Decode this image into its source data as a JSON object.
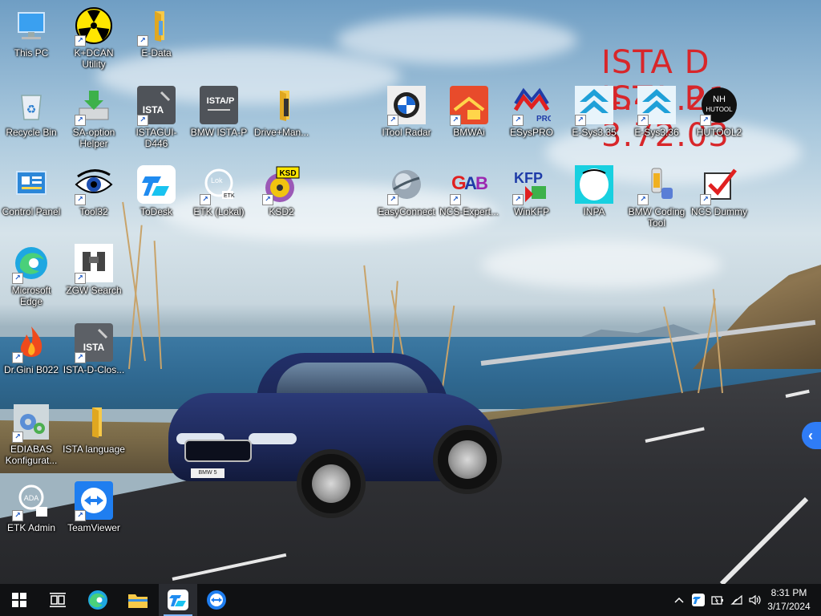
{
  "watermark": {
    "line1": "ISTA D 4.46.21",
    "line2": "ISTA P 3.72.03",
    "color": "#d8262a"
  },
  "desktop_icons": [
    {
      "label": "This PC",
      "icon": "this-pc-icon"
    },
    {
      "label": "K+DCAN Utility",
      "icon": "radiation-icon"
    },
    {
      "label": "E-Data",
      "icon": "folder-icon"
    },
    {
      "label": "Recycle Bin",
      "icon": "recycle-bin-icon"
    },
    {
      "label": "SA-option Helper",
      "icon": "download-icon"
    },
    {
      "label": "ISTAGUI-D446",
      "icon": "ista-icon"
    },
    {
      "label": "BMW ISTA-P",
      "icon": "ista-p-icon"
    },
    {
      "label": "Drive+Man...",
      "icon": "folder-icon"
    },
    {
      "label": "Control Panel",
      "icon": "control-panel-icon"
    },
    {
      "label": "Tool32",
      "icon": "eye-icon"
    },
    {
      "label": "ToDesk",
      "icon": "todesk-icon"
    },
    {
      "label": "ETK (Lokal)",
      "icon": "etk-icon"
    },
    {
      "label": "KSD2",
      "icon": "ksd-icon"
    },
    {
      "label": "Microsoft Edge",
      "icon": "edge-icon"
    },
    {
      "label": "ZGW Search",
      "icon": "binoculars-icon"
    },
    {
      "label": "Dr.Gini B022",
      "icon": "flame-icon"
    },
    {
      "label": "ISTA-D-Clos...",
      "icon": "ista-icon"
    },
    {
      "label": "EDIABAS Konfigurat...",
      "icon": "gears-icon"
    },
    {
      "label": "ISTA language",
      "icon": "folder-icon"
    },
    {
      "label": "ETK Admin",
      "icon": "etk-admin-icon"
    },
    {
      "label": "TeamViewer",
      "icon": "teamviewer-icon"
    },
    {
      "label": "ITool Radar",
      "icon": "bmw-logo-icon"
    },
    {
      "label": "BMWAi",
      "icon": "bmwai-icon"
    },
    {
      "label": "ESysPRO",
      "icon": "esyspro-icon"
    },
    {
      "label": "E-Sys3.35",
      "icon": "esys-icon"
    },
    {
      "label": "E-Sys3.36",
      "icon": "esys-icon"
    },
    {
      "label": "HUTOOL2",
      "icon": "hutool-icon"
    },
    {
      "label": "EasyConnect",
      "icon": "globe-icon"
    },
    {
      "label": "NCS-Expert...",
      "icon": "gabi-icon"
    },
    {
      "label": "WinKFP",
      "icon": "kfp-icon"
    },
    {
      "label": "INPA",
      "icon": "inpa-icon"
    },
    {
      "label": "BMW Coding Tool",
      "icon": "coding-tool-icon"
    },
    {
      "label": "NCS Dummy",
      "icon": "checkmark-icon"
    }
  ],
  "taskbar": {
    "items": [
      {
        "name": "start-button",
        "icon": "windows-icon"
      },
      {
        "name": "task-view-button",
        "icon": "task-view-icon"
      },
      {
        "name": "edge-taskbar-button",
        "icon": "edge-icon"
      },
      {
        "name": "file-explorer-button",
        "icon": "folder-icon"
      },
      {
        "name": "todesk-taskbar-button",
        "icon": "todesk-icon"
      },
      {
        "name": "teamviewer-taskbar-button",
        "icon": "teamviewer-icon"
      }
    ],
    "tray_icons": [
      "chevron-up-icon",
      "todesk-tray-icon",
      "battery-icon",
      "wifi-icon",
      "volume-icon"
    ],
    "time": "8:31 PM",
    "date": "3/17/2024"
  },
  "side_tab": {
    "icon": "chevron-left-icon",
    "glyph": "‹"
  }
}
